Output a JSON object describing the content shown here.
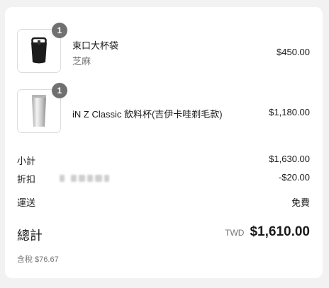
{
  "items": [
    {
      "name": "束口大杯袋",
      "variant": "芝麻",
      "price": "$450.00",
      "quantity": "1",
      "image_icon": "black-cup-bag-icon"
    },
    {
      "name": "iN Z Classic 飲料杯(吉伊卡哇剃毛款)",
      "variant": "",
      "price": "$1,180.00",
      "quantity": "1",
      "image_icon": "silver-tumbler-icon"
    }
  ],
  "summary": {
    "subtotal_label": "小計",
    "subtotal_value": "$1,630.00",
    "discount_label": "折扣",
    "discount_value": "-$20.00",
    "shipping_label": "運送",
    "shipping_value": "免費",
    "total_label": "總計",
    "total_currency": "TWD",
    "total_value": "$1,610.00",
    "tax_note": "含稅 $76.67"
  },
  "colors": {
    "badge": "#707070",
    "muted_text": "#777777",
    "card_bg": "#ffffff",
    "page_bg": "#f2f2f2"
  }
}
